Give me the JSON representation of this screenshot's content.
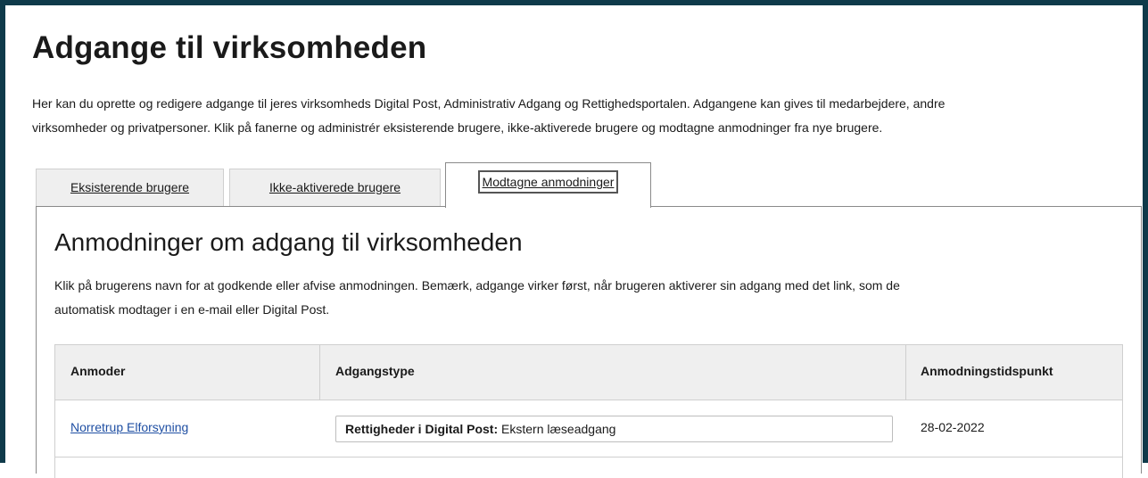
{
  "page": {
    "title": "Adgange til virksomheden",
    "intro_line1": "Her kan du oprette og redigere adgange til jeres virksomheds Digital Post, Administrativ Adgang og Rettighedsportalen. Adgangene kan gives til medarbejdere, andre",
    "intro_line2": "virksomheder og privatpersoner. Klik på fanerne og administrér eksisterende brugere, ikke-aktiverede brugere og modtagne anmodninger fra nye brugere."
  },
  "tabs": [
    {
      "label": "Eksisterende brugere",
      "active": false
    },
    {
      "label": "Ikke-aktiverede brugere",
      "active": false
    },
    {
      "label": "Modtagne anmodninger",
      "active": true
    }
  ],
  "panel": {
    "title": "Anmodninger om adgang til virksomheden",
    "text_line1": "Klik på brugerens navn for at godkende eller afvise anmodningen. Bemærk, adgange virker først, når brugeren aktiverer sin adgang med det link, som de",
    "text_line2": "automatisk modtager i en e-mail eller Digital Post."
  },
  "table": {
    "headers": [
      "Anmoder",
      "Adgangstype",
      "Anmodningstidspunkt"
    ],
    "rows": [
      {
        "requester": "Norretrup Elforsyning",
        "access_label": "Rettigheder i Digital Post:",
        "access_value": "Ekstern læseadgang",
        "date": "28-02-2022"
      }
    ]
  },
  "colors": {
    "frame": "#0f3a4a",
    "link": "#1f4fa3",
    "header_bg": "#efefef"
  }
}
